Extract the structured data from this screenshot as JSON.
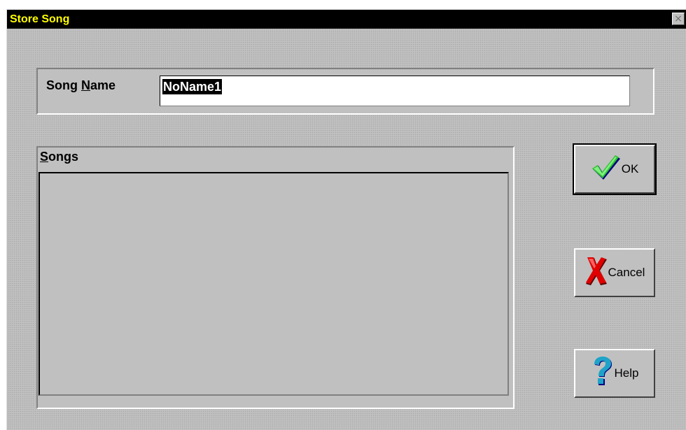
{
  "window": {
    "title": "Store Song",
    "close_symbol": "×"
  },
  "song_name": {
    "label_before": "Song ",
    "label_mnemonic": "N",
    "label_after": "ame",
    "value": "NoName1"
  },
  "songs": {
    "label_mnemonic": "S",
    "label_rest": "ongs",
    "items": []
  },
  "buttons": {
    "ok": {
      "label": "OK",
      "icon": "checkmark-icon"
    },
    "cancel": {
      "label": "Cancel",
      "icon": "x-mark-icon"
    },
    "help": {
      "label": "Help",
      "icon": "question-mark-icon"
    }
  }
}
